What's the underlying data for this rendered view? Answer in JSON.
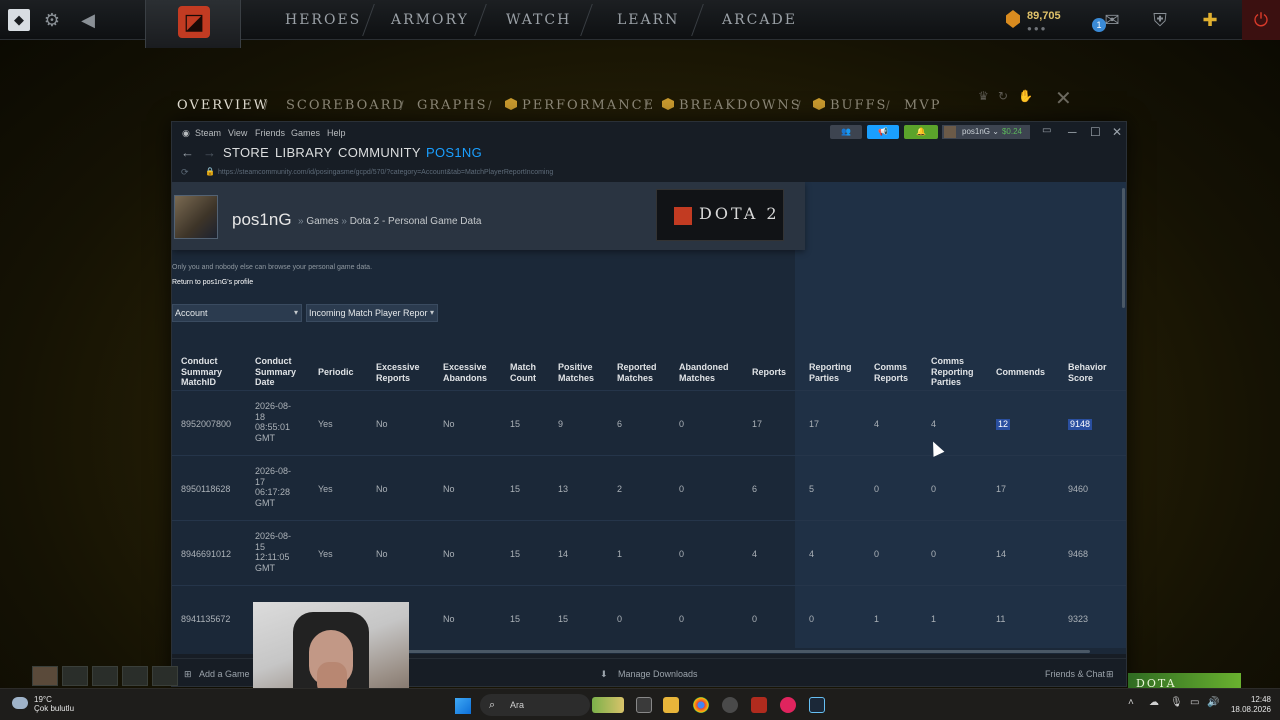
{
  "dota": {
    "nav": [
      "HEROES",
      "ARMORY",
      "WATCH",
      "LEARN",
      "ARCADE"
    ],
    "shards": "89,705",
    "notif_count": "1",
    "postgame_tabs": [
      "OVERVIEW",
      "SCOREBOARD",
      "GRAPHS",
      "PERFORMANCE",
      "BREAKDOWNS",
      "BUFFS",
      "MVP"
    ],
    "banner": "DOTA"
  },
  "steam": {
    "menu": [
      "Steam",
      "View",
      "Friends",
      "Games",
      "Help"
    ],
    "nav": [
      "STORE",
      "LIBRARY",
      "COMMUNITY",
      "POS1NG"
    ],
    "url": "https://steamcommunity.com/id/posingasme/gcpd/570/?category=Account&tab=MatchPlayerReportIncoming",
    "user": {
      "name": "pos1nG",
      "balance": "$0.24"
    },
    "footer": {
      "add_game": "Add a Game",
      "downloads": "Manage Downloads",
      "friends": "Friends & Chat"
    }
  },
  "page": {
    "profile_name": "pos1nG",
    "breadcrumb": [
      "Games",
      "Dota 2 - Personal Game Data"
    ],
    "game_logo": "DOTA 2",
    "privacy_note": "Only you and nobody else can browse your personal game data.",
    "return_link": "Return to pos1nG's profile",
    "category_select": "Account",
    "tab_select": "Incoming Match Player Repor",
    "columns": [
      "Conduct Summary MatchID",
      "Conduct Summary Date",
      "Periodic",
      "Excessive Reports",
      "Excessive Abandons",
      "Match Count",
      "Positive Matches",
      "Reported Matches",
      "Abandoned Matches",
      "Reports",
      "Reporting Parties",
      "Comms Reports",
      "Comms Reporting Parties",
      "Commends",
      "Behavior Score"
    ],
    "rows": [
      [
        "8952007800",
        "2026-08-18 08:55:01 GMT",
        "Yes",
        "No",
        "No",
        "15",
        "9",
        "6",
        "0",
        "17",
        "17",
        "4",
        "4",
        "12",
        "9148"
      ],
      [
        "8950118628",
        "2026-08-17 06:17:28 GMT",
        "Yes",
        "No",
        "No",
        "15",
        "13",
        "2",
        "0",
        "6",
        "5",
        "0",
        "0",
        "17",
        "9460"
      ],
      [
        "8946691012",
        "2026-08-15 12:11:05 GMT",
        "Yes",
        "No",
        "No",
        "15",
        "14",
        "1",
        "0",
        "4",
        "4",
        "0",
        "0",
        "14",
        "9468"
      ],
      [
        "8941135672",
        "",
        "",
        "No",
        "No",
        "15",
        "15",
        "0",
        "0",
        "0",
        "0",
        "1",
        "1",
        "11",
        "9323"
      ]
    ]
  },
  "taskbar": {
    "weather_temp": "19°C",
    "weather_desc": "Çok bulutlu",
    "search": "Ara",
    "time": "12:48",
    "date": "18.08.2026"
  }
}
